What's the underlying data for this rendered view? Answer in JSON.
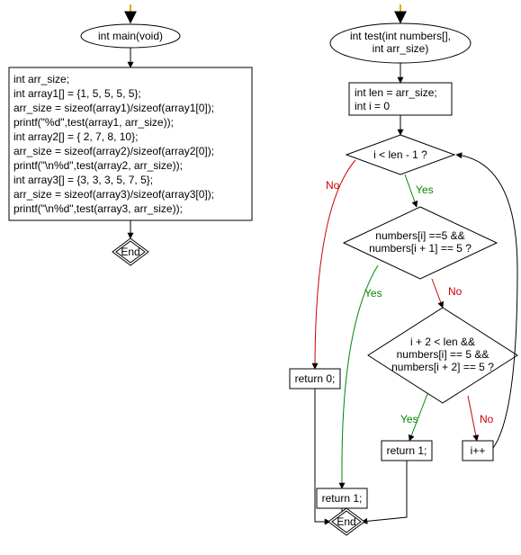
{
  "left": {
    "start_arrow": true,
    "func_header": "int main(void)",
    "code_lines": [
      "int arr_size;",
      "int array1[] = {1, 5, 5, 5, 5};",
      "arr_size = sizeof(array1)/sizeof(array1[0]);",
      "printf(\"%d\",test(array1, arr_size));",
      "int array2[] = { 2, 7, 8, 10};",
      "arr_size = sizeof(array2)/sizeof(array2[0]);",
      "printf(\"\\n%d\",test(array2, arr_size));",
      "int array3[] = {3, 3, 3, 5, 7, 5};",
      "arr_size = sizeof(array3)/sizeof(array3[0]);",
      "printf(\"\\n%d\",test(array3, arr_size));"
    ],
    "end_label": "End"
  },
  "right": {
    "start_arrow": true,
    "func_header_l1": "int test(int numbers[],",
    "func_header_l2": "int arr_size)",
    "init_l1": "int len = arr_size;",
    "init_l2": "int i = 0",
    "cond1": "i < len - 1 ?",
    "cond2_l1": "numbers[i] ==5 &&",
    "cond2_l2": "numbers[i + 1] == 5 ?",
    "cond3_l1": "i + 2 < len &&",
    "cond3_l2": "numbers[i] == 5 &&",
    "cond3_l3": "numbers[i + 2] == 5 ?",
    "return0": "return 0;",
    "return1a": "return 1;",
    "return1b": "return 1;",
    "inc": "i++",
    "end_label": "End",
    "yes": "Yes",
    "no": "No"
  }
}
